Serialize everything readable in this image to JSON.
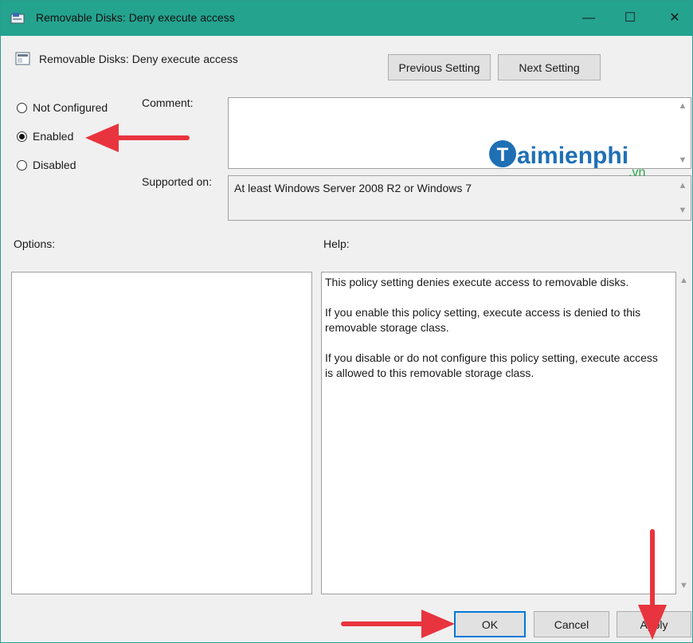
{
  "window": {
    "title": "Removable Disks: Deny execute access",
    "controls": [
      "—",
      "☐",
      "✕"
    ]
  },
  "header": {
    "title": "Removable Disks: Deny execute access",
    "previous_label": "Previous Setting",
    "next_label": "Next Setting"
  },
  "state": {
    "options": [
      {
        "label": "Not Configured",
        "selected": false
      },
      {
        "label": "Enabled",
        "selected": true
      },
      {
        "label": "Disabled",
        "selected": false
      }
    ]
  },
  "comment": {
    "label": "Comment:",
    "value": ""
  },
  "supported": {
    "label": "Supported on:",
    "value": "At least Windows Server 2008 R2 or Windows 7"
  },
  "options_label": "Options:",
  "help": {
    "label": "Help:",
    "paragraphs": [
      "This policy setting denies execute access to removable disks.",
      "If you enable this policy setting, execute access is denied to this removable storage class.",
      "If you disable or do not configure this policy setting, execute access is allowed to this removable storage class."
    ]
  },
  "footer": {
    "ok_label": "OK",
    "cancel_label": "Cancel",
    "apply_label": "Apply"
  },
  "watermark": {
    "brand": "aimienphi",
    "initial": "T",
    "tld": ".vn"
  },
  "colors": {
    "titlebar": "#24a38f",
    "arrow": "#e8343e",
    "accent": "#0078d7"
  }
}
